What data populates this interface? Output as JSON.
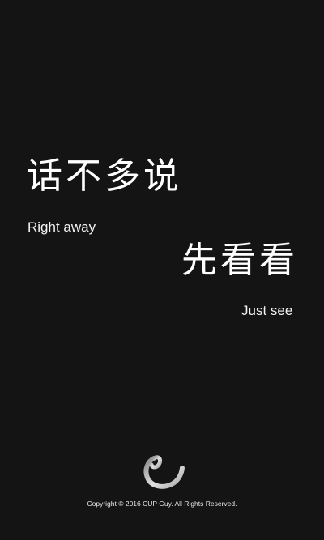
{
  "headline": {
    "line1_cn": "话不多说",
    "line1_en": "Right away",
    "line2_cn": "先看看",
    "line2_en": "Just see"
  },
  "logo": {
    "icon": "swirl-logo-icon",
    "color": "#d9d9d9"
  },
  "footer": {
    "copyright": "Copyright © 2016 CUP Guy. All Rights Reserved."
  },
  "colors": {
    "background": "#141414",
    "text": "#ffffff"
  }
}
